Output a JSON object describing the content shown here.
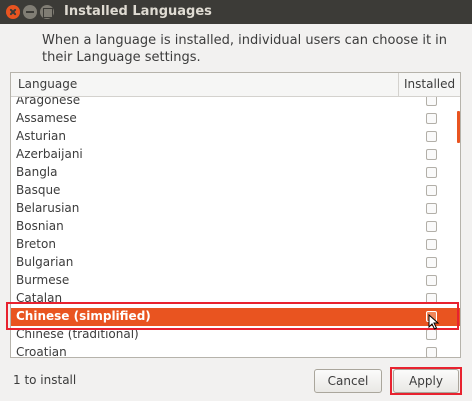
{
  "window": {
    "title": "Installed Languages",
    "description": "When a language is installed, individual users can choose it in their Language settings."
  },
  "list": {
    "columns": {
      "language": "Language",
      "installed": "Installed"
    },
    "rows": [
      {
        "name": "Aragonese",
        "installed": false,
        "selected": false
      },
      {
        "name": "Assamese",
        "installed": false,
        "selected": false
      },
      {
        "name": "Asturian",
        "installed": false,
        "selected": false
      },
      {
        "name": "Azerbaijani",
        "installed": false,
        "selected": false
      },
      {
        "name": "Bangla",
        "installed": false,
        "selected": false
      },
      {
        "name": "Basque",
        "installed": false,
        "selected": false
      },
      {
        "name": "Belarusian",
        "installed": false,
        "selected": false
      },
      {
        "name": "Bosnian",
        "installed": false,
        "selected": false
      },
      {
        "name": "Breton",
        "installed": false,
        "selected": false
      },
      {
        "name": "Bulgarian",
        "installed": false,
        "selected": false
      },
      {
        "name": "Burmese",
        "installed": false,
        "selected": false
      },
      {
        "name": "Catalan",
        "installed": false,
        "selected": false
      },
      {
        "name": "Chinese (simplified)",
        "installed": false,
        "selected": true
      },
      {
        "name": "Chinese (traditional)",
        "installed": false,
        "selected": false
      },
      {
        "name": "Croatian",
        "installed": false,
        "selected": false
      }
    ]
  },
  "footer": {
    "status": "1 to install",
    "cancel_label": "Cancel",
    "apply_label": "Apply"
  },
  "colors": {
    "accent": "#e95420",
    "highlight_box": "#e8222f",
    "titlebar": "#3c3b37"
  }
}
